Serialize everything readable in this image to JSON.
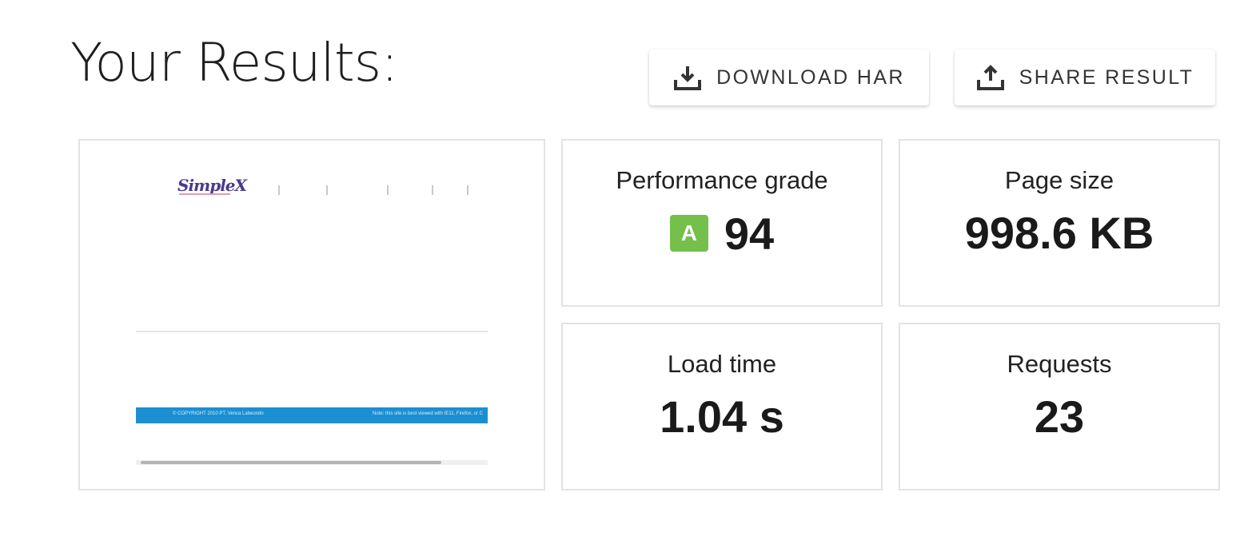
{
  "header": {
    "title": "Your Results:",
    "download_label": "DOWNLOAD HAR",
    "download_icon": "download-icon",
    "share_label": "SHARE RESULT",
    "share_icon": "share-icon"
  },
  "thumbnail": {
    "logo_text": "SimpleX",
    "footer_left": "© COPYRIGHT 2010 PT. Venca Labeondo",
    "footer_right": "Note: this site is best viewed with IE11, Firefox, or C"
  },
  "metrics": {
    "performance": {
      "label": "Performance grade",
      "grade": "A",
      "score": "94",
      "grade_color": "#74c04b"
    },
    "page_size": {
      "label": "Page size",
      "value": "998.6 KB"
    },
    "load_time": {
      "label": "Load time",
      "value": "1.04 s"
    },
    "requests": {
      "label": "Requests",
      "value": "23"
    }
  },
  "colors": {
    "accent_footer": "#1b8fd2",
    "card_border": "#e3e3e3"
  }
}
